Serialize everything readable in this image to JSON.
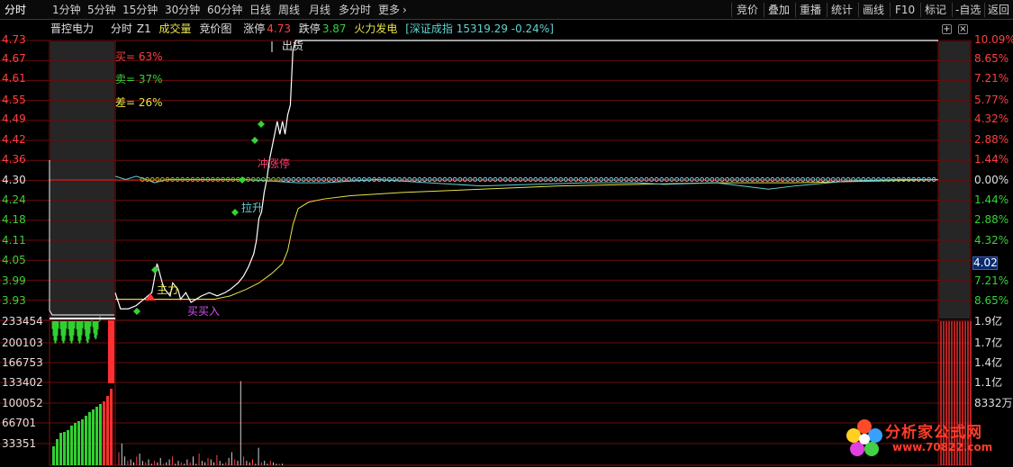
{
  "toolbar": {
    "left_items": [
      "分时",
      "1分钟",
      "5分钟",
      "15分钟",
      "30分钟",
      "60分钟",
      "日线",
      "周线",
      "月线",
      "多分时",
      "更多"
    ],
    "more_arrow": "›",
    "right_items": [
      "竞价",
      "叠加",
      "重播",
      "统计",
      "画线",
      "F10",
      "标记",
      "-自选",
      "返回"
    ]
  },
  "info": {
    "stock_name": "晋控电力",
    "tab_timeshare": "分时",
    "tab_z1": "Z1",
    "tab_volume": "成交量",
    "tab_auction": "竞价图",
    "limit_up_label": "涨停",
    "limit_up_value": "4.73",
    "limit_down_label": "跌停",
    "limit_down_value": "3.87",
    "sector": "火力发电",
    "index_text": "[深证成指 15319.29 -0.24%]"
  },
  "corner_buttons": {
    "add": "+",
    "close": "×"
  },
  "price_axis": {
    "left": [
      "4.73",
      "4.67",
      "4.61",
      "4.55",
      "4.49",
      "4.42",
      "4.36",
      "4.30",
      "4.24",
      "4.18",
      "4.11",
      "4.05",
      "3.99",
      "3.93"
    ],
    "right": [
      "10.09%",
      "8.65%",
      "7.21%",
      "5.77%",
      "4.32%",
      "2.88%",
      "1.44%",
      "0.00%",
      "1.44%",
      "2.88%",
      "4.32%",
      "5.77%",
      "7.21%",
      "8.65%"
    ],
    "current_price_tag": "4.02"
  },
  "volume_axis": {
    "left": [
      "233454",
      "200103",
      "166753",
      "133402",
      "100052",
      "66701",
      "33351"
    ],
    "right": [
      "1.9亿",
      "1.7亿",
      "1.4亿",
      "1.1亿",
      "8332万"
    ]
  },
  "annotations": {
    "buy_pct": "买= 63%",
    "sell_pct": "卖= 37%",
    "diff_pct": "差= 26%",
    "ship_out": "出货",
    "limit_rush": "冲涨停",
    "pull_up": "拉升",
    "main_force": "主力",
    "buy_in": "买买入"
  },
  "chart_data": {
    "type": "line",
    "title": "",
    "xlabel": "",
    "ylabel": "",
    "ylim": [
      3.87,
      4.73
    ],
    "prev_close": 4.3,
    "series": [
      {
        "name": "",
        "color": "#ffffff",
        "points": [
          [
            0,
            3.95
          ],
          [
            2,
            3.9
          ],
          [
            5,
            3.9
          ],
          [
            8,
            3.91
          ],
          [
            11,
            3.93
          ],
          [
            14,
            3.95
          ],
          [
            16,
            4.04
          ],
          [
            18,
            3.98
          ],
          [
            19,
            3.96
          ],
          [
            21,
            3.94
          ],
          [
            22,
            3.98
          ],
          [
            24,
            3.96
          ],
          [
            25,
            3.93
          ],
          [
            27,
            3.95
          ],
          [
            29,
            3.92
          ],
          [
            31,
            3.93
          ],
          [
            33,
            3.94
          ],
          [
            36,
            3.95
          ],
          [
            39,
            3.94
          ],
          [
            42,
            3.95
          ],
          [
            44,
            3.96
          ],
          [
            47,
            3.98
          ],
          [
            49,
            4.0
          ],
          [
            51,
            4.03
          ],
          [
            53,
            4.07
          ],
          [
            54,
            4.11
          ],
          [
            55,
            4.18
          ],
          [
            56,
            4.2
          ],
          [
            57,
            4.26
          ],
          [
            58,
            4.3
          ],
          [
            59,
            4.36
          ],
          [
            60,
            4.4
          ],
          [
            61,
            4.44
          ],
          [
            62,
            4.48
          ],
          [
            63,
            4.44
          ],
          [
            64,
            4.48
          ],
          [
            65,
            4.44
          ],
          [
            66,
            4.5
          ],
          [
            67,
            4.53
          ],
          [
            68,
            4.7
          ],
          [
            69,
            4.73
          ],
          [
            85,
            4.73
          ],
          [
            315,
            4.73
          ]
        ]
      },
      {
        "name": "",
        "color": "#e6e34a",
        "points": [
          [
            0,
            3.93
          ],
          [
            10,
            3.93
          ],
          [
            20,
            3.93
          ],
          [
            30,
            3.93
          ],
          [
            38,
            3.93
          ],
          [
            44,
            3.94
          ],
          [
            50,
            3.96
          ],
          [
            55,
            3.98
          ],
          [
            60,
            4.01
          ],
          [
            64,
            4.04
          ],
          [
            66,
            4.08
          ],
          [
            68,
            4.16
          ],
          [
            70,
            4.21
          ],
          [
            74,
            4.23
          ],
          [
            80,
            4.24
          ],
          [
            90,
            4.25
          ],
          [
            110,
            4.26
          ],
          [
            140,
            4.27
          ],
          [
            170,
            4.28
          ],
          [
            200,
            4.285
          ],
          [
            230,
            4.29
          ],
          [
            260,
            4.29
          ],
          [
            290,
            4.295
          ],
          [
            315,
            4.3
          ]
        ]
      },
      {
        "name": "",
        "color": "#5fd3d3",
        "points": [
          [
            0,
            4.31
          ],
          [
            4,
            4.3
          ],
          [
            8,
            4.31
          ],
          [
            12,
            4.3
          ],
          [
            15,
            4.29
          ],
          [
            20,
            4.3
          ],
          [
            30,
            4.3
          ],
          [
            50,
            4.3
          ],
          [
            70,
            4.29
          ],
          [
            80,
            4.29
          ],
          [
            100,
            4.3
          ],
          [
            120,
            4.29
          ],
          [
            140,
            4.28
          ],
          [
            160,
            4.285
          ],
          [
            180,
            4.29
          ],
          [
            200,
            4.29
          ],
          [
            210,
            4.285
          ],
          [
            230,
            4.29
          ],
          [
            250,
            4.27
          ],
          [
            260,
            4.28
          ],
          [
            280,
            4.295
          ],
          [
            300,
            4.3
          ],
          [
            315,
            4.3
          ]
        ]
      }
    ],
    "volume": [
      9,
      15,
      6,
      3,
      4,
      2,
      6,
      8,
      3,
      2,
      4,
      1,
      3,
      2,
      5,
      1,
      2,
      4,
      6,
      1,
      3,
      2,
      1,
      4,
      2,
      6,
      1,
      8,
      3,
      2,
      5,
      4,
      2,
      7,
      3,
      1,
      2,
      5,
      9,
      4,
      3,
      58,
      6,
      3,
      2,
      4,
      1,
      12,
      2,
      3,
      1,
      3,
      2,
      1,
      1,
      1
    ]
  }
}
